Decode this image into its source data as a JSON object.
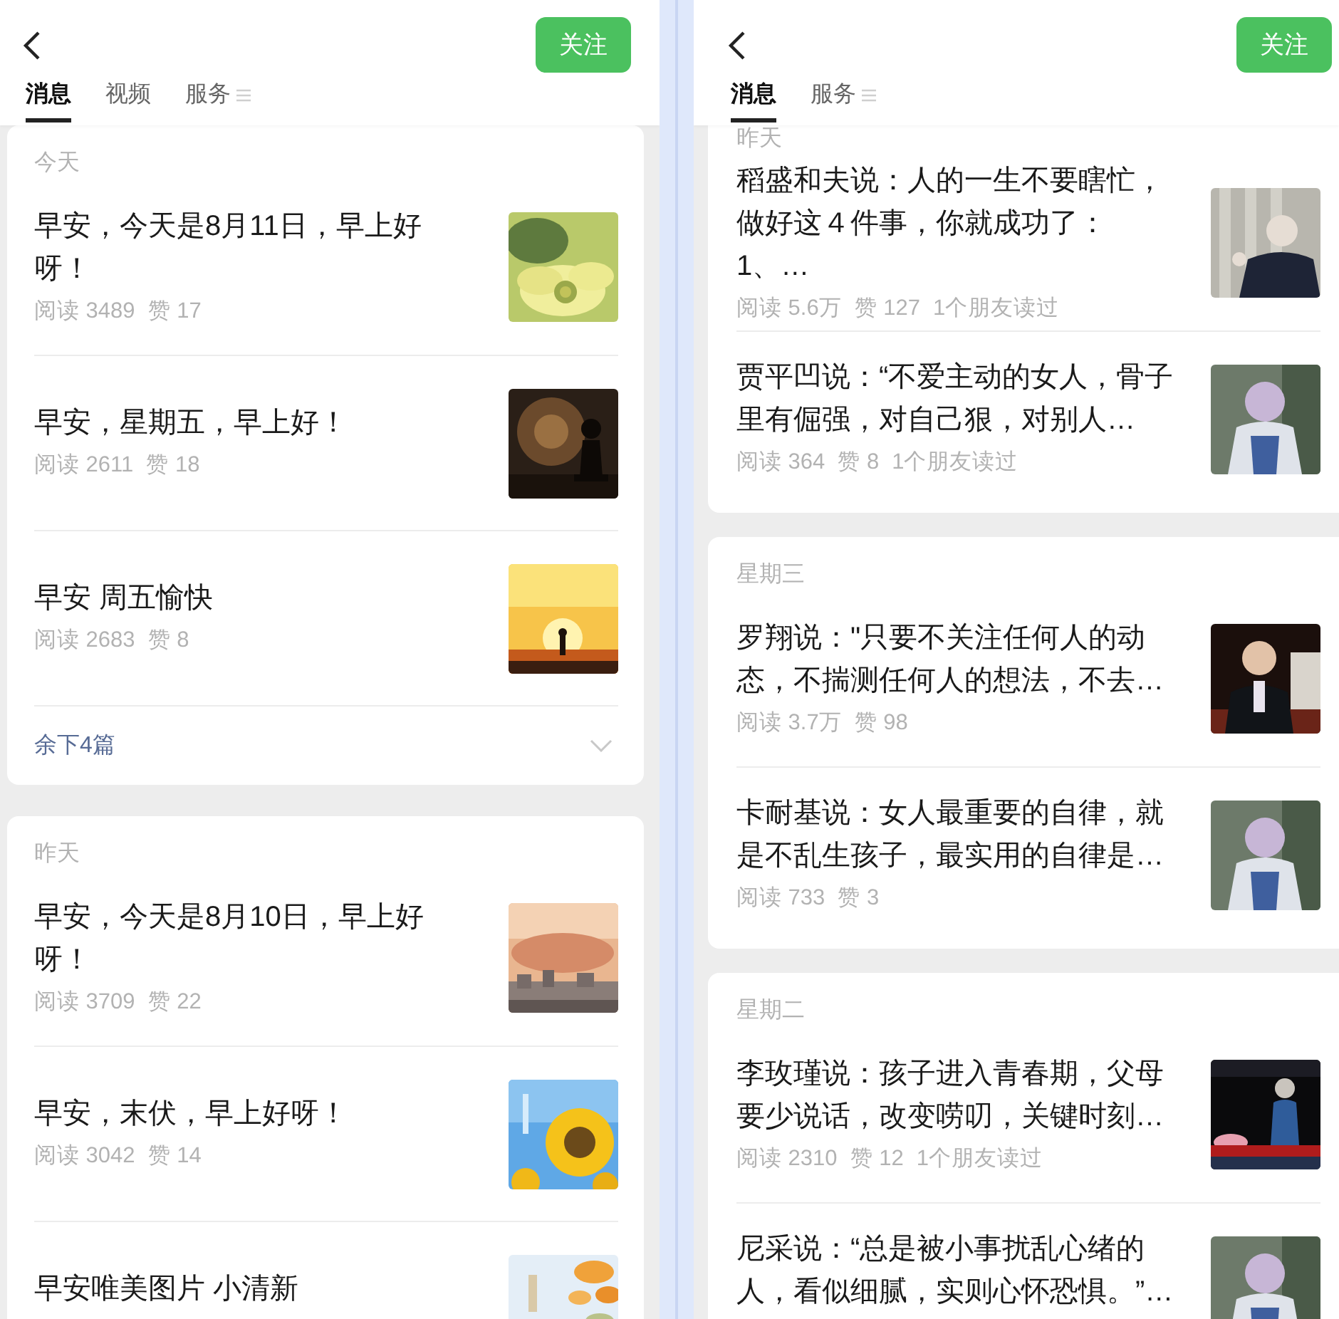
{
  "panels": [
    {
      "follow_button": "关注",
      "tabs": [
        {
          "label": "消息",
          "selected": true
        },
        {
          "label": "视频",
          "selected": false
        },
        {
          "label": "服务",
          "selected": false
        }
      ],
      "groups": [
        {
          "date": "今天",
          "articles": [
            {
              "title": "早安，今天是8月11日，早上好呀！",
              "meta": [
                "阅读 3489",
                "赞 17"
              ]
            },
            {
              "title": "早安，星期五，早上好！",
              "meta": [
                "阅读 2611",
                "赞 18"
              ]
            },
            {
              "title": "早安 周五愉快",
              "meta": [
                "阅读 2683",
                "赞 8"
              ]
            }
          ],
          "more": "余下4篇"
        },
        {
          "date": "昨天",
          "articles": [
            {
              "title": "早安，今天是8月10日，早上好呀！",
              "meta": [
                "阅读 3709",
                "赞 22"
              ]
            },
            {
              "title": "早安，末伏，早上好呀！",
              "meta": [
                "阅读 3042",
                "赞 14"
              ]
            },
            {
              "title": "早安唯美图片 小清新"
            }
          ]
        }
      ]
    },
    {
      "follow_button": "关注",
      "tabs": [
        {
          "label": "消息",
          "selected": true
        },
        {
          "label": "服务",
          "selected": false
        }
      ],
      "groups": [
        {
          "date": "昨天",
          "articles": [
            {
              "title": "稻盛和夫说：人的一生不要瞎忙，做好这４件事，你就成功了：1、…",
              "meta": [
                "阅读 5.6万",
                "赞 127",
                "1个朋友读过"
              ]
            },
            {
              "title": "贾平凹说：“不爱主动的女人，骨子里有倔强，对自己狠，对别人…",
              "meta": [
                "阅读 364",
                "赞 8",
                "1个朋友读过"
              ]
            }
          ]
        },
        {
          "date": "星期三",
          "articles": [
            {
              "title": "罗翔说：\"只要不关注任何人的动态，不揣测任何人的想法，不去…",
              "meta": [
                "阅读 3.7万",
                "赞 98"
              ]
            },
            {
              "title": "卡耐基说：女人最重要的自律，就是不乱生孩子，最实用的自律是…",
              "meta": [
                "阅读 733",
                "赞 3"
              ]
            }
          ]
        },
        {
          "date": "星期二",
          "articles": [
            {
              "title": "李玫瑾说：孩子进入青春期，父母要少说话，改变唠叨，关键时刻…",
              "meta": [
                "阅读 2310",
                "赞 12",
                "1个朋友读过"
              ]
            },
            {
              "title": "尼采说：“总是被小事扰乱心绪的人，看似细腻，实则心怀恐惧。”…"
            }
          ]
        }
      ]
    }
  ]
}
